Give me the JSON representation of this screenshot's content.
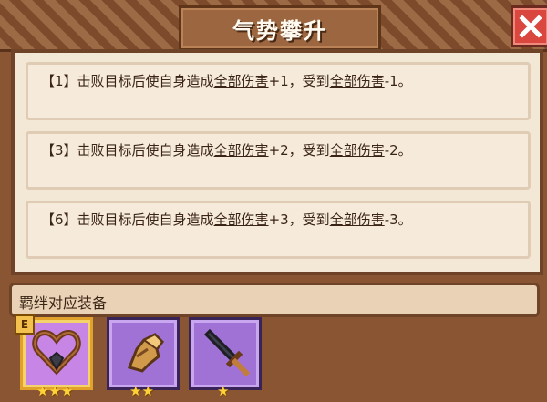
{
  "header": {
    "title": "气势攀升"
  },
  "rules": [
    {
      "prefix": "【1】击败目标后使自身造成",
      "link1": "全部伤害",
      "mid": "+1，受到",
      "link2": "全部伤害",
      "suffix": "-1。"
    },
    {
      "prefix": "【3】击败目标后使自身造成",
      "link1": "全部伤害",
      "mid": "+2，受到",
      "link2": "全部伤害",
      "suffix": "-2。"
    },
    {
      "prefix": "【6】击败目标后使自身造成",
      "link1": "全部伤害",
      "mid": "+3，受到",
      "link2": "全部伤害",
      "suffix": "-3。"
    }
  ],
  "equipment_section": {
    "label": "羁绊对应装备",
    "tier_badge": "E",
    "items": [
      {
        "icon": "heart-necklace-icon",
        "stars": "★★★"
      },
      {
        "icon": "gauntlet-icon",
        "stars": "★★"
      },
      {
        "icon": "sword-icon",
        "stars": "★"
      }
    ]
  },
  "colors": {
    "accent_purple": "#a072d6",
    "close_red": "#d9473e",
    "star_gold": "#ffd23a"
  }
}
